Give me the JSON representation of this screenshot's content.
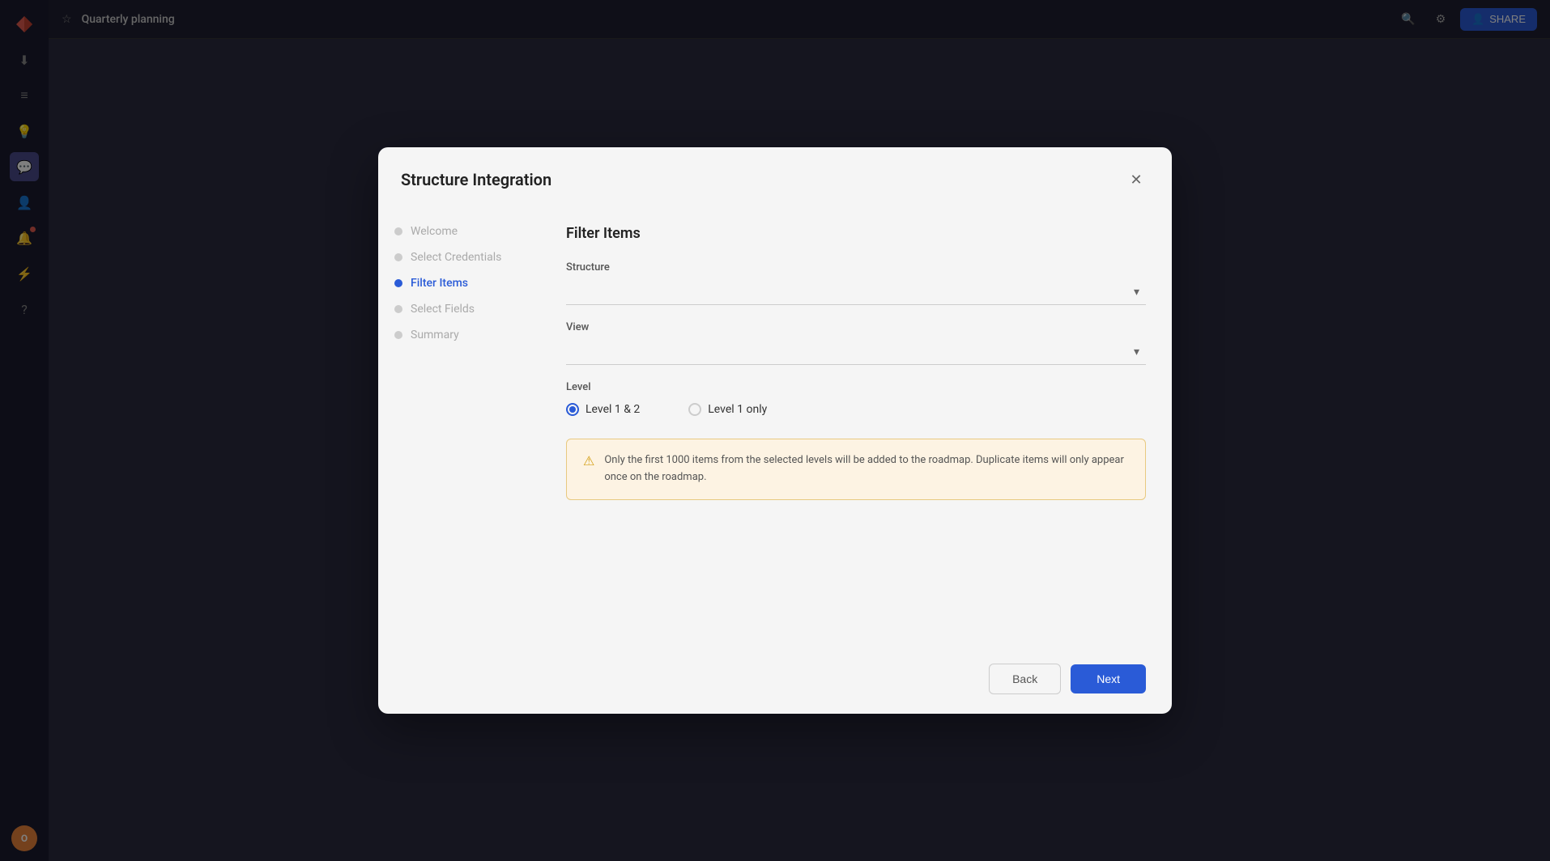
{
  "app": {
    "title": "Quarterly planning",
    "share_label": "SHARE"
  },
  "sidebar": {
    "items": [
      {
        "name": "logo",
        "icon": "✦"
      },
      {
        "name": "download",
        "icon": "⬇"
      },
      {
        "name": "list",
        "icon": "≡"
      },
      {
        "name": "lightning",
        "icon": "⚡"
      },
      {
        "name": "chat",
        "icon": "💬",
        "active": true
      },
      {
        "name": "contact",
        "icon": "👤"
      },
      {
        "name": "bell",
        "icon": "🔔"
      },
      {
        "name": "zap",
        "icon": "⚡"
      },
      {
        "name": "help",
        "icon": "?"
      }
    ],
    "avatar": "O"
  },
  "modal": {
    "title": "Structure Integration",
    "steps": [
      {
        "label": "Welcome",
        "active": false
      },
      {
        "label": "Select Credentials",
        "active": false
      },
      {
        "label": "Filter Items",
        "active": true
      },
      {
        "label": "Select Fields",
        "active": false
      },
      {
        "label": "Summary",
        "active": false
      }
    ],
    "panel": {
      "title": "Filter Items",
      "structure_label": "Structure",
      "structure_placeholder": "",
      "view_label": "View",
      "view_placeholder": "",
      "level_label": "Level",
      "level_options": [
        {
          "label": "Level 1 & 2",
          "selected": true
        },
        {
          "label": "Level 1 only",
          "selected": false
        }
      ],
      "warning_text": "Only the first 1000 items from the selected levels will be added to the roadmap. Duplicate items will only appear once on the roadmap."
    },
    "footer": {
      "back_label": "Back",
      "next_label": "Next"
    }
  }
}
